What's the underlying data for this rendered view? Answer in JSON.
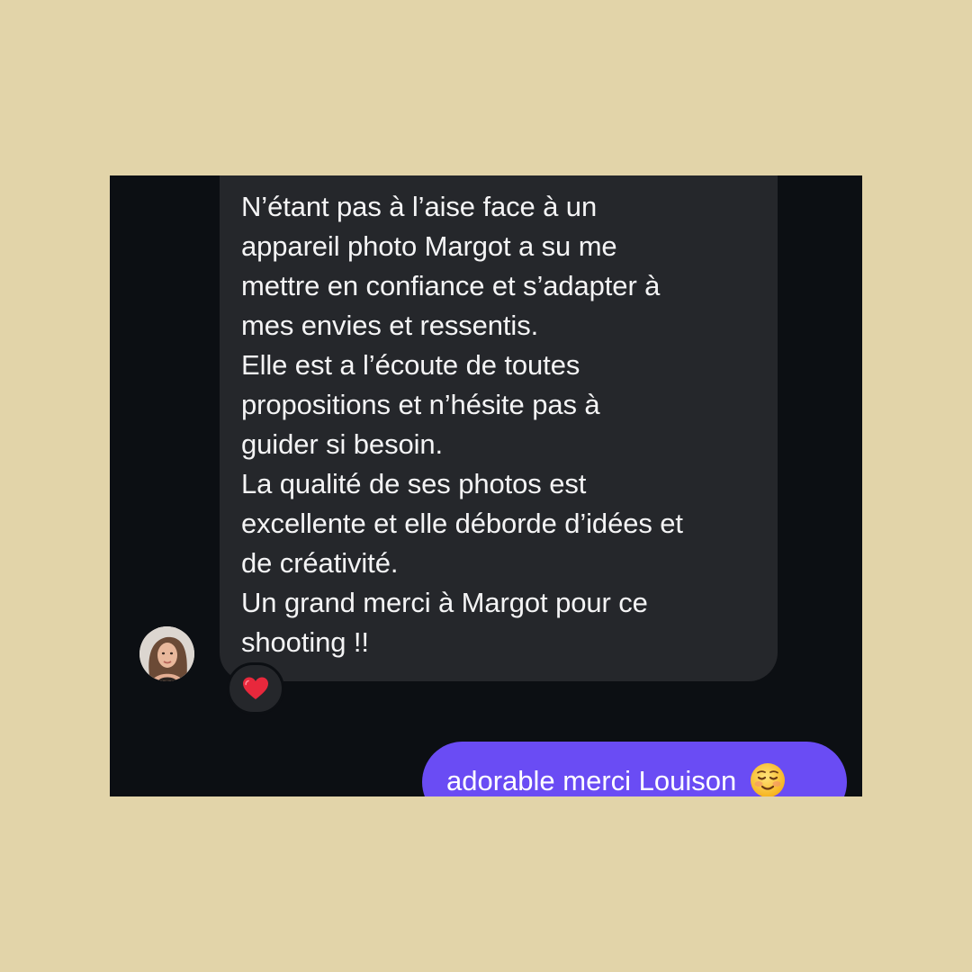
{
  "conversation": {
    "received_message": {
      "paragraphs": [
        "N’étant pas à l’aise face à un\nappareil photo Margot a su me\nmettre en confiance et s’adapter à\nmes envies et ressentis.",
        "Elle est a l’écoute de toutes\npropositions et n’hésite pas à\nguider si besoin.",
        "La qualité de ses photos est\nexcellente et elle déborde d’idées et\nde créativité.",
        "Un grand merci à Margot pour ce\nshooting !!"
      ],
      "reaction_icon": "red-heart-icon"
    },
    "sent_message": {
      "text": "adorable merci Louison",
      "emoji_icon": "smiling-face-icon"
    }
  },
  "colors": {
    "page_background": "#e2d4a9",
    "chat_background": "#0c0f13",
    "received_bubble": "#25272b",
    "sent_bubble": "#6a4cf4",
    "heart": "#e8283c"
  }
}
